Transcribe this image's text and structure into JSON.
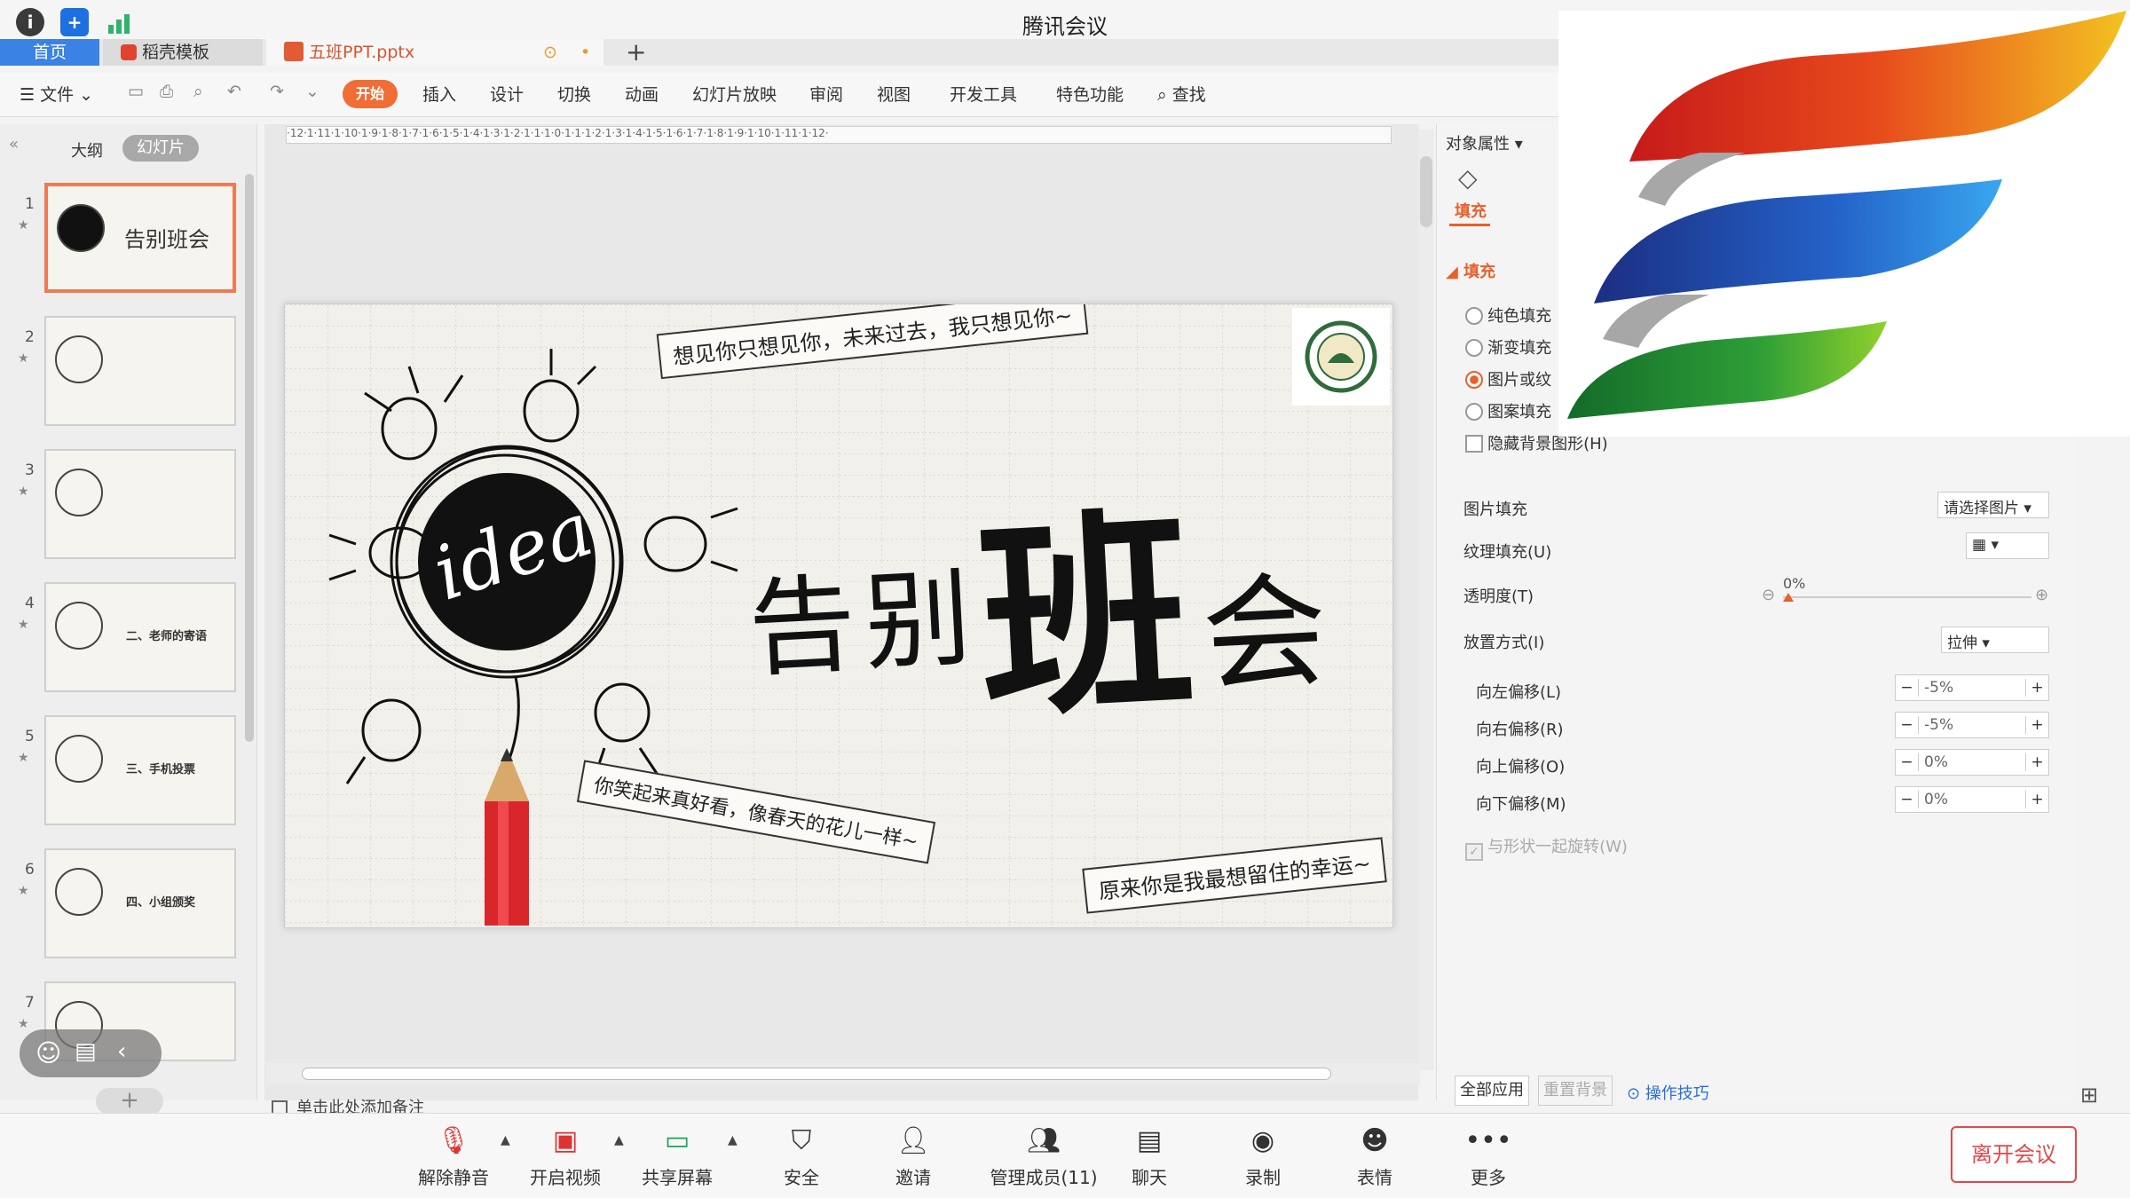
{
  "app": {
    "title": "腾讯会议"
  },
  "tabs": {
    "home": "首页",
    "template": "稻壳模板",
    "file": "五班PPT.pptx",
    "add": "+"
  },
  "ribbon": {
    "file_menu": "文件",
    "items": [
      "开始",
      "插入",
      "设计",
      "切换",
      "动画",
      "幻灯片放映",
      "审阅",
      "视图",
      "开发工具",
      "特色功能",
      "查找"
    ]
  },
  "left_panel": {
    "tab_outline": "大纲",
    "tab_slides": "幻灯片",
    "slides": [
      {
        "num": "1",
        "text": "告别班会"
      },
      {
        "num": "2",
        "text": ""
      },
      {
        "num": "3",
        "text": ""
      },
      {
        "num": "4",
        "text": "二、老师的寄语"
      },
      {
        "num": "5",
        "text": "三、手机投票"
      },
      {
        "num": "6",
        "text": "四、小组颁奖"
      },
      {
        "num": "7",
        "text": ""
      }
    ],
    "add_slide": "+"
  },
  "editor": {
    "ruler": "·12·1·11·1·10·1·9·1·8·1·7·1·6·1·5·1·4·1·3·1·2·1·1·1·0·1·1·1·2·1·3·1·4·1·5·1·6·1·7·1·8·1·9·1·10·1·11·1·12·",
    "notes_placeholder": "单击此处添加备注"
  },
  "slide": {
    "quote_top": "想见你只想见你，未来过去，我只想见你~",
    "idea_word": "idea",
    "title_part1": "告别",
    "title_big": "班",
    "title_part2": "会",
    "quote_bottom_left": "你笑起来真好看，像春天的花儿一样~",
    "quote_bottom_right": "原来你是我最想留住的幸运~"
  },
  "right_panel": {
    "title": "对象属性",
    "fill_tab": "填充",
    "fill_section": "填充",
    "options": [
      "纯色填充",
      "渐变填充",
      "图片或纹",
      "图案填充"
    ],
    "hide_bg": "隐藏背景图形(H)",
    "picture_fill_label": "图片填充",
    "picture_fill_value": "请选择图片",
    "texture_label": "纹理填充(U)",
    "transparency_label": "透明度(T)",
    "transparency_value": "0%",
    "placement_label": "放置方式(I)",
    "placement_value": "拉伸",
    "offsets": [
      {
        "label": "向左偏移(L)",
        "value": "-5%"
      },
      {
        "label": "向右偏移(R)",
        "value": "-5%"
      },
      {
        "label": "向上偏移(O)",
        "value": "0%"
      },
      {
        "label": "向下偏移(M)",
        "value": "0%"
      }
    ],
    "rotate_with_shape": "与形状一起旋转(W)",
    "apply_all": "全部应用",
    "reset_bg": "重置背景",
    "tips": "操作技巧"
  },
  "bottom_bar": {
    "buttons": [
      "解除静音",
      "开启视频",
      "共享屏幕",
      "安全",
      "邀请",
      "管理成员(11)",
      "聊天",
      "录制",
      "表情",
      "更多"
    ],
    "leave": "离开会议"
  }
}
